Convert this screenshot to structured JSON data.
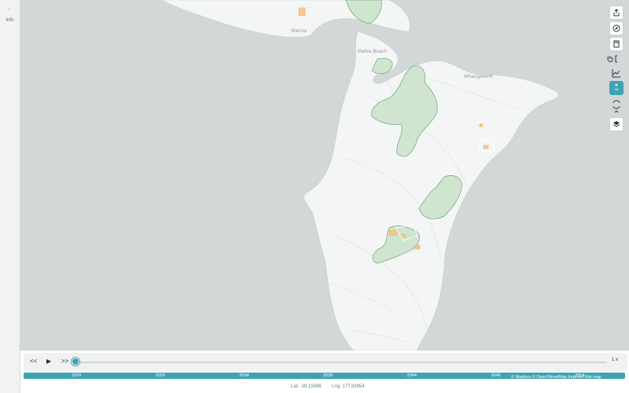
{
  "sidebar": {
    "collapse_label": "←",
    "info_label": "Info"
  },
  "map": {
    "labels": {
      "wairoa": "Wairoa",
      "mahia": "Mahia Beach",
      "whangawehi": "Whangawehi"
    },
    "colors": {
      "water": "#d2d7d8",
      "land": "#f4f6f5",
      "forest": "#cfe5cf",
      "forest_outline": "#6fa27a",
      "development": "#f3c98c"
    }
  },
  "toolbar": {
    "icons": [
      "share-icon",
      "compass-icon",
      "bookmark-icon",
      "pan-hand-icon",
      "chart-icon",
      "three-d-icon",
      "rotate-icon",
      "layers-icon"
    ]
  },
  "timeline": {
    "rewind_label": "<<",
    "play_label": "▶",
    "forward_label": ">>",
    "speed_label": "1 x",
    "progress": 0.0,
    "years": [
      "2024",
      "2029",
      "2034",
      "2039",
      "2044",
      "2049",
      "2054"
    ]
  },
  "coordinates": {
    "lat_label": "Lat: -39.15696",
    "lng_label": "Lng: 177.83954"
  },
  "attribution": "© Mapbox © OpenStreetMap  Improve this map",
  "accent_color": "#3fa3b1"
}
